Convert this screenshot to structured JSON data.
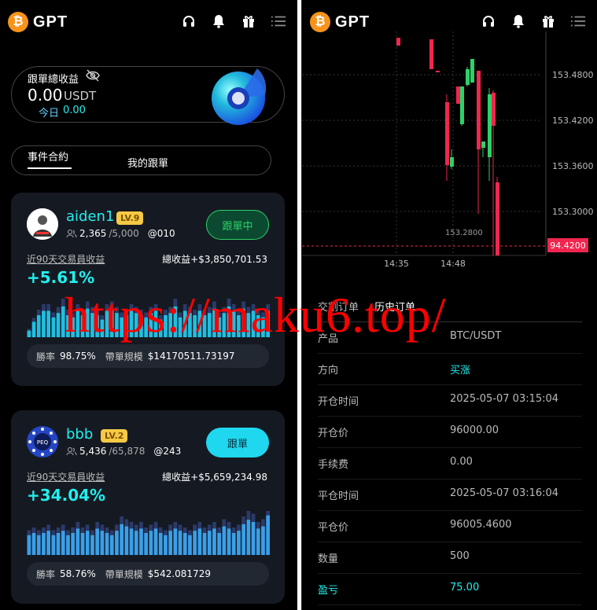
{
  "app": {
    "brand": "GPT",
    "logo_glyph": "₿"
  },
  "summary": {
    "label": "跟單總收益",
    "value": "0.00",
    "unit": "USDT",
    "today_label": "今日",
    "today_value": "0.00"
  },
  "tabs": [
    {
      "label": "事件合約"
    },
    {
      "label": "我的跟單"
    }
  ],
  "traders": [
    {
      "name": "aiden1",
      "level": "LV.9",
      "followers": "2,365",
      "capacity": "/5,000",
      "code": "@010",
      "button": "跟單中",
      "label_90": "近90天交易員收益",
      "total_label": "總收益",
      "total_value": "+$3,850,701.53",
      "pct": "+5.61%",
      "win_label": "勝率",
      "win_value": "98.75%",
      "scale_label": "帶單規模",
      "scale_value": "$14170511.73197",
      "bars": [
        0.15,
        0.35,
        0.5,
        0.6,
        0.6,
        0.45,
        0.55,
        0.7,
        0.5,
        0.45,
        0.6,
        0.5,
        0.65,
        0.55,
        0.5,
        0.4,
        0.6,
        0.65,
        0.55,
        0.45,
        0.5,
        0.6,
        0.55,
        0.5,
        0.45,
        0.55,
        0.6,
        0.4,
        0.5,
        0.55,
        0.7,
        0.45,
        0.6,
        0.55,
        0.5,
        0.6,
        0.5,
        0.55,
        0.65,
        0.45,
        0.55,
        0.7,
        0.6,
        0.5,
        0.65,
        0.55,
        0.6,
        0.5,
        0.45,
        0.6
      ]
    },
    {
      "name": "bbb",
      "level": "LV.2",
      "followers": "5,436",
      "capacity": "/65,878",
      "code": "@243",
      "button": "跟單",
      "label_90": "近90天交易員收益",
      "total_label": "總收益",
      "total_value": "+$5,659,234.98",
      "pct": "+34.04%",
      "win_label": "勝率",
      "win_value": "58.76%",
      "scale_label": "帶單規模",
      "scale_value": "$542.081729",
      "bars": [
        0.45,
        0.5,
        0.45,
        0.5,
        0.55,
        0.45,
        0.5,
        0.55,
        0.45,
        0.5,
        0.6,
        0.5,
        0.55,
        0.45,
        0.6,
        0.55,
        0.5,
        0.45,
        0.55,
        0.7,
        0.65,
        0.6,
        0.55,
        0.6,
        0.5,
        0.55,
        0.6,
        0.5,
        0.45,
        0.55,
        0.6,
        0.55,
        0.5,
        0.45,
        0.55,
        0.6,
        0.5,
        0.55,
        0.6,
        0.5,
        0.65,
        0.6,
        0.5,
        0.55,
        0.7,
        0.8,
        0.75,
        0.6,
        0.65,
        0.9
      ]
    }
  ],
  "chart_data": {
    "type": "candlestick",
    "y_ticks": [
      "153.4800",
      "153.4200",
      "153.3600",
      "153.3000"
    ],
    "x_ticks": [
      "14:35",
      "14:48"
    ],
    "last_price_label": "94.4200",
    "low_marker": "153.2800"
  },
  "order_tabs": [
    {
      "label": "交割订单"
    },
    {
      "label": "历史订单"
    }
  ],
  "details": [
    {
      "label": "产品",
      "value": "BTC/USDT"
    },
    {
      "label": "方向",
      "value": "买涨"
    },
    {
      "label": "开仓时间",
      "value": "2025-05-07 03:15:04"
    },
    {
      "label": "开仓价",
      "value": "96000.00"
    },
    {
      "label": "手续费",
      "value": "0.00"
    },
    {
      "label": "平仓时间",
      "value": "2025-05-07 03:16:04"
    },
    {
      "label": "平仓价",
      "value": "96005.4600"
    },
    {
      "label": "数量",
      "value": "500"
    },
    {
      "label": "盈亏",
      "value": "75.00"
    }
  ],
  "watermark": "https://maku6.top/",
  "colors": {
    "accent": "#22e5ee",
    "up": "#2ed068",
    "down": "#f0264f",
    "gold": "#f6c945"
  }
}
